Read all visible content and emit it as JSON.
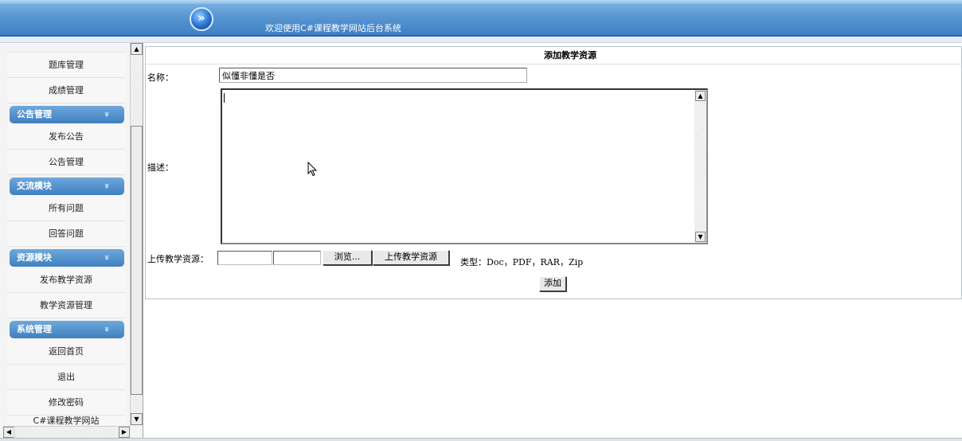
{
  "header": {
    "logo_glyph": "»",
    "welcome": "欢迎使用C#课程教学网站后台系统"
  },
  "sidebar": {
    "items_top": [
      {
        "label": "题库管理"
      },
      {
        "label": "成绩管理"
      }
    ],
    "sections": [
      {
        "title": "公告管理",
        "chevron": "»",
        "items": [
          {
            "label": "发布公告"
          },
          {
            "label": "公告管理"
          }
        ]
      },
      {
        "title": "交流模块",
        "chevron": "»",
        "items": [
          {
            "label": "所有问题"
          },
          {
            "label": "回答问题"
          }
        ]
      },
      {
        "title": "资源模块",
        "chevron": "»",
        "items": [
          {
            "label": "发布教学资源"
          },
          {
            "label": "教学资源管理"
          }
        ]
      },
      {
        "title": "系统管理",
        "chevron": "»",
        "items": [
          {
            "label": "返回首页"
          },
          {
            "label": "退出"
          },
          {
            "label": "修改密码"
          }
        ]
      }
    ],
    "partial_item": "C#课程教学网站"
  },
  "form": {
    "title": "添加教学资源",
    "name_label": "名称：",
    "name_value": "似懂非懂是否",
    "desc_label": "描述：",
    "desc_value": "",
    "upload_label": "上传教学资源：",
    "browse_button": "浏览...",
    "upload_button": "上传教学资源",
    "types_text": "类型：Doc，PDF，RAR，Zip",
    "add_button": "添加"
  },
  "icons": {
    "up": "▲",
    "down": "▼",
    "left": "◀",
    "right": "▶"
  }
}
